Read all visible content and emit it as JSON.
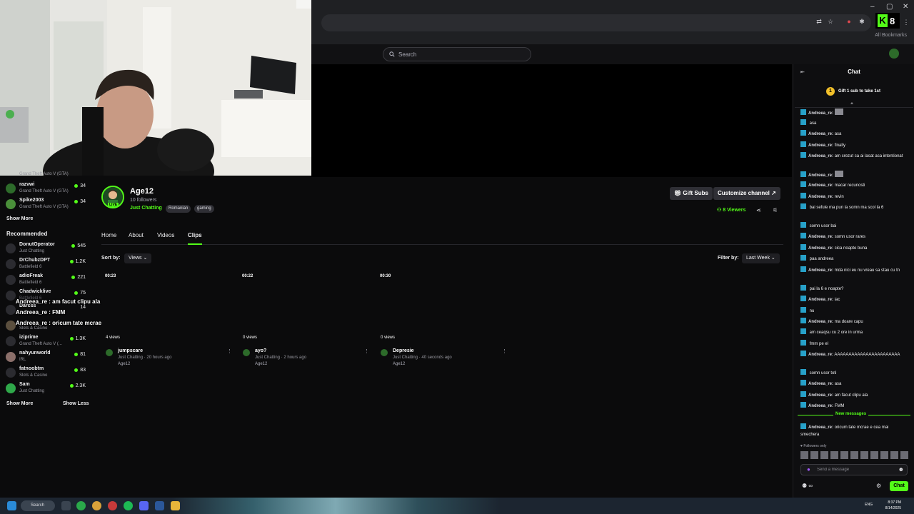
{
  "browser": {
    "bookmarks_label": "All Bookmarks",
    "extension_badge": "8",
    "window_min": "–",
    "window_max": "▢",
    "window_close": "✕"
  },
  "header": {
    "search_placeholder": "Search"
  },
  "sidebar": {
    "top_items": [
      {
        "name": "razvwi",
        "category": "Grand Theft Auto V (GTA)",
        "viewers": "34"
      },
      {
        "name": "Spike2003",
        "category": "Grand Theft Auto V (GTA)",
        "viewers": "34"
      }
    ],
    "top_category_fragment": "Grand Theft Auto V (GTA)",
    "show_more": "Show More",
    "recommended_title": "Recommended",
    "recommended": [
      {
        "name": "DonutOperator",
        "category": "Just Chatting",
        "viewers": "545"
      },
      {
        "name": "DrChubzDPT",
        "category": "Battlefield 6",
        "viewers": "1.2K"
      },
      {
        "name": "adioFreak",
        "category": "Battlefield 6",
        "viewers": "221"
      },
      {
        "name": "Chadwicklive",
        "category": "Battlefield 6",
        "viewers": "75"
      },
      {
        "name": "Darcss",
        "category": "",
        "viewers": "14"
      },
      {
        "name": "",
        "category": "Slots & Casino",
        "viewers": ""
      },
      {
        "name": "iziprime",
        "category": "Grand Theft Auto V (...",
        "viewers": "1.3K"
      },
      {
        "name": "nahyunworld",
        "category": "IRL",
        "viewers": "81"
      },
      {
        "name": "fatnoobtm",
        "category": "Slots & Casino",
        "viewers": "83"
      },
      {
        "name": "Sam",
        "category": "Just Chatting",
        "viewers": "2.3K"
      }
    ],
    "show_more_bottom": "Show More",
    "show_less": "Show Less"
  },
  "overlay_chat": [
    "Andreea_re : am facut clipu ala",
    "Andreea_re : FMM",
    "Andreea_re : oricum tate mcrae e cea mai smechera"
  ],
  "channel": {
    "name": "Age12",
    "followers": "10 followers",
    "category": "Just Chatting",
    "tags": [
      "Romanian",
      "gaming"
    ],
    "live_badge": "LIVE",
    "gift_subs": "Gift Subs",
    "customize": "Customize channel",
    "viewers": "8 Viewers"
  },
  "tabs": [
    "Home",
    "About",
    "Videos",
    "Clips"
  ],
  "active_tab": "Clips",
  "controls": {
    "sort_label": "Sort by:",
    "sort_value": "Views",
    "filter_label": "Filter by:",
    "filter_value": "Last Week"
  },
  "clips": [
    {
      "duration": "00:23",
      "views": "4 views",
      "title": "jumpscare",
      "category": "Just Chatting",
      "age": "20 hours ago",
      "author": "Age12"
    },
    {
      "duration": "00:22",
      "views": "0 views",
      "title": "ayo?",
      "category": "Just Chatting",
      "age": "2 hours ago",
      "author": "Age12"
    },
    {
      "duration": "00:30",
      "views": "0 views",
      "title": "Depresie",
      "category": "Just Chatting",
      "age": "40 seconds ago",
      "author": "Age12"
    }
  ],
  "chat": {
    "title": "Chat",
    "gift_banner": "Gift 1 sub to take 1st",
    "gift_rank": "1",
    "messages": [
      {
        "user": "Andreea_re:",
        "red": false,
        "text": "",
        "emote": true
      },
      {
        "user": "",
        "red": true,
        "text": "asa",
        "emote": false
      },
      {
        "user": "Andreea_re:",
        "red": false,
        "text": "asa",
        "emote": false
      },
      {
        "user": "Andreea_re:",
        "red": false,
        "text": "finally",
        "emote": false
      },
      {
        "user": "Andreea_re:",
        "red": false,
        "text": "am crezut ca ai lasat asa intentionat",
        "emote": false
      },
      {
        "user": "Andreea_re:",
        "red": false,
        "text": "",
        "emote": true
      },
      {
        "user": "Andreea_re:",
        "red": false,
        "text": "macar recunosti",
        "emote": false
      },
      {
        "user": "Andreea_re:",
        "red": false,
        "text": "revin",
        "emote": false
      },
      {
        "user": "",
        "red": true,
        "text": "bai sefule ma pun la somn ma scol la 6",
        "emote": false
      },
      {
        "user": "",
        "red": true,
        "text": "somn usor bai",
        "emote": false
      },
      {
        "user": "Andreea_re:",
        "red": false,
        "text": "somn usor rares",
        "emote": false
      },
      {
        "user": "Andreea_re:",
        "red": false,
        "text": "cica noapte buna",
        "emote": false
      },
      {
        "user": "",
        "red": true,
        "text": "paa andreea",
        "emote": false
      },
      {
        "user": "Andreea_re:",
        "red": false,
        "text": "mda nici eu nu vreau sa stau cu tn",
        "emote": false
      },
      {
        "user": "",
        "red": true,
        "text": "pai la 6 e noapte?",
        "emote": false
      },
      {
        "user": "Andreea_re:",
        "red": false,
        "text": "iac",
        "emote": false
      },
      {
        "user": "",
        "red": true,
        "text": "nu",
        "emote": false
      },
      {
        "user": "Andreea_re:",
        "red": false,
        "text": "ma doare capu",
        "emote": false
      },
      {
        "user": "",
        "red": true,
        "text": "am ceaqsu cu 2 ore in urma",
        "emote": false
      },
      {
        "user": "",
        "red": true,
        "text": "fmm pe el",
        "emote": false
      },
      {
        "user": "Andreea_re:",
        "red": false,
        "text": "AAAAAAAAAAAAAAAAAAAAAAA",
        "emote": false
      },
      {
        "user": "",
        "red": true,
        "text": "somn usor toti",
        "emote": false
      },
      {
        "user": "Andreea_re:",
        "red": false,
        "text": "asa",
        "emote": false
      },
      {
        "user": "Andreea_re:",
        "red": false,
        "text": "am facut clipu ala",
        "emote": false
      },
      {
        "user": "Andreea_re:",
        "red": false,
        "text": "FMM",
        "emote": false
      }
    ],
    "new_messages": "New messages",
    "last_message": {
      "user": "Andreea_re:",
      "text": "oricum tate mcrae e cea mai smechera"
    },
    "followers_only": "Followers only",
    "input_placeholder": "Send a message",
    "send_label": "Chat"
  },
  "taskbar": {
    "search": "Search",
    "lang": "ENG",
    "time": "8:37 PM",
    "date": "8/14/2025"
  },
  "colors": {
    "accent": "#53fc18",
    "background": "#0b0b0c",
    "chat_badge": "#27a1c9",
    "chat_red_user": "#d63b5a"
  }
}
